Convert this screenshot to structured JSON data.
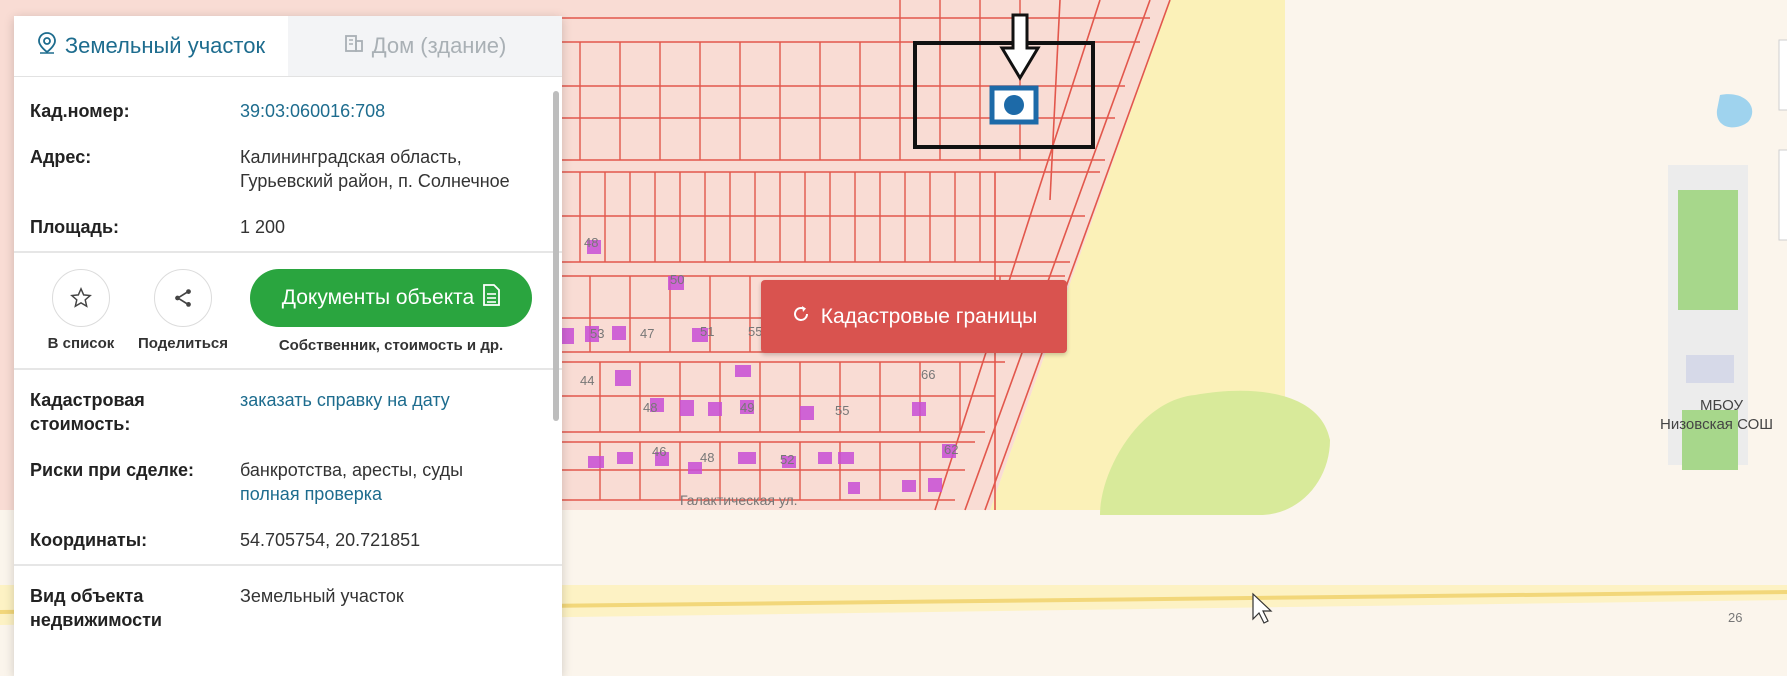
{
  "tabs": [
    {
      "label": "Земельный участок",
      "icon": "map-pin-icon",
      "active": true
    },
    {
      "label": "Дом (здание)",
      "icon": "building-icon",
      "active": false
    }
  ],
  "parcel": {
    "kad_label": "Кад.номер:",
    "kad_value": "39:03:060016:708",
    "address_label": "Адрес:",
    "address_line1": "Калининградская область,",
    "address_line2": "Гурьевский район, п. Солнечное",
    "area_label": "Площадь:",
    "area_value": "1 200"
  },
  "actions": {
    "favorite_label": "В список",
    "share_label": "Поделиться",
    "docs_label": "Документы объекта",
    "docs_sub": "Собственник, стоимость и др."
  },
  "details": {
    "cost_label_1": "Кадастровая",
    "cost_label_2": "стоимость:",
    "cost_link": "заказать справку на дату",
    "risks_label": "Риски при сделке:",
    "risks_value": "банкротства, аресты, суды",
    "risks_link": "полная проверка",
    "coords_label": "Координаты:",
    "coords_value": "54.705754, 20.721851",
    "type_label_1": "Вид объекта",
    "type_label_2": "недвижимости",
    "type_value": "Земельный участок"
  },
  "map": {
    "kadastr_button": "Кадастровые границы",
    "street_label": "Галактическая ул.",
    "school_label_1": "МБОУ",
    "school_label_2": "Низовская СОШ",
    "house_numbers": [
      "48",
      "50",
      "53",
      "47",
      "51",
      "55",
      "44",
      "48",
      "49",
      "55",
      "66",
      "46",
      "48",
      "52",
      "62",
      "26"
    ]
  },
  "colors": {
    "accent": "#1d6c8e",
    "docs_green": "#2aa53f",
    "kadastr_red": "#d9534f",
    "parcel_line": "#e2574c"
  }
}
